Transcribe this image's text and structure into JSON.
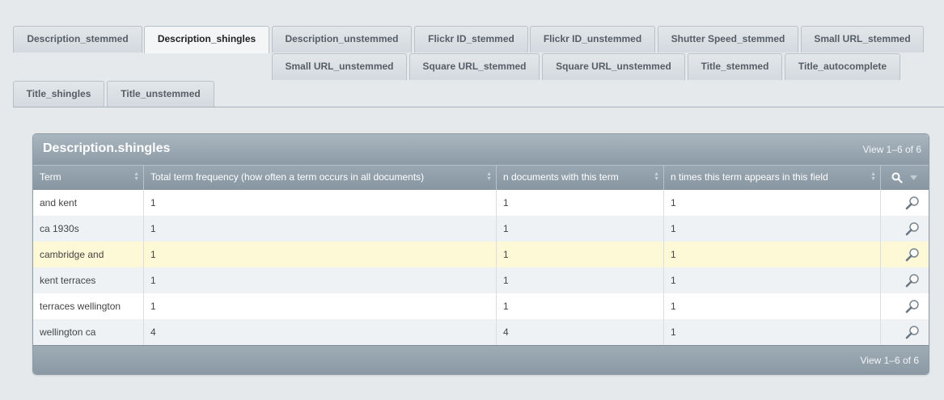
{
  "tabs": [
    {
      "label": "Description_stemmed",
      "active": false
    },
    {
      "label": "Description_shingles",
      "active": true
    },
    {
      "label": "Description_unstemmed",
      "active": false
    },
    {
      "label": "Flickr ID_stemmed",
      "active": false
    },
    {
      "label": "Flickr ID_unstemmed",
      "active": false
    },
    {
      "label": "Shutter Speed_stemmed",
      "active": false
    },
    {
      "label": "Small URL_stemmed",
      "active": false
    },
    {
      "label": "Small URL_unstemmed",
      "active": false
    },
    {
      "label": "Square URL_stemmed",
      "active": false
    },
    {
      "label": "Square URL_unstemmed",
      "active": false
    },
    {
      "label": "Title_stemmed",
      "active": false
    },
    {
      "label": "Title_autocomplete",
      "active": false
    },
    {
      "label": "Title_shingles",
      "active": false
    },
    {
      "label": "Title_unstemmed",
      "active": false
    }
  ],
  "grid": {
    "title": "Description.shingles",
    "view_text": "View 1–6 of 6",
    "footer_view_text": "View 1–6 of 6",
    "columns": [
      "Term",
      "Total term frequency (how often a term occurs in all documents)",
      "n documents with this term",
      "n times this term appears in this field"
    ],
    "rows": [
      {
        "term": "and kent",
        "total": "1",
        "docs": "1",
        "times": "1",
        "highlighted": false
      },
      {
        "term": "ca 1930s",
        "total": "1",
        "docs": "1",
        "times": "1",
        "highlighted": false
      },
      {
        "term": "cambridge and",
        "total": "1",
        "docs": "1",
        "times": "1",
        "highlighted": true
      },
      {
        "term": "kent terraces",
        "total": "1",
        "docs": "1",
        "times": "1",
        "highlighted": false
      },
      {
        "term": "terraces wellington",
        "total": "1",
        "docs": "1",
        "times": "1",
        "highlighted": false
      },
      {
        "term": "wellington ca",
        "total": "4",
        "docs": "4",
        "times": "1",
        "highlighted": false
      }
    ],
    "row_action_icon": "magnifier-icon",
    "header_tools": [
      "search-icon",
      "caret-down-icon"
    ]
  },
  "colors": {
    "header_bg": "#9aa8b3",
    "row_alt": "#eef2f5",
    "row_highlight": "#fdf9d6",
    "page_bg": "#e6e9ec"
  }
}
